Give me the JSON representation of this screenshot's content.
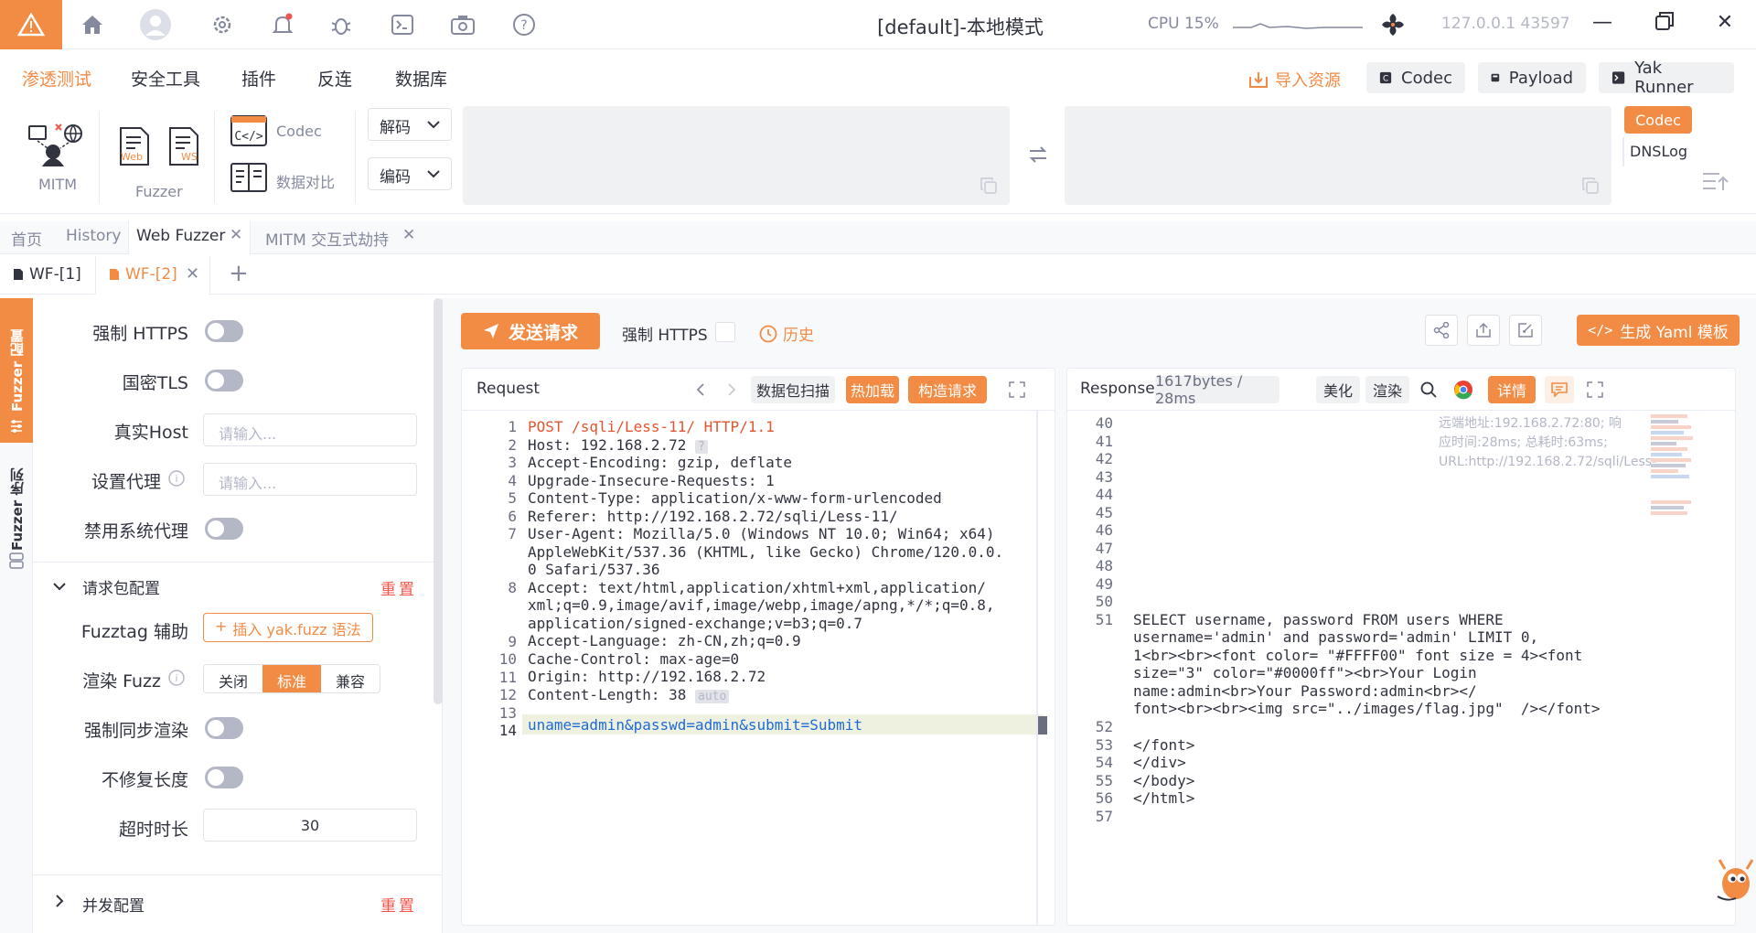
{
  "titlebar": {
    "title": "[default]-本地模式",
    "cpu": "CPU 15%",
    "ip": "127.0.0.1 43597"
  },
  "menu": {
    "items": [
      "渗透测试",
      "安全工具",
      "插件",
      "反连",
      "数据库"
    ],
    "import": "导入资源",
    "codec": "Codec",
    "payload": "Payload",
    "yak_runner": "Yak Runner"
  },
  "ribbon": {
    "mitm": "MITM",
    "fuzzer": "Fuzzer",
    "web_badge": "Web",
    "ws_badge": "WS",
    "codec": "Codec",
    "compare": "数据对比",
    "decode": "解码",
    "encode": "编码",
    "right_codec": "Codec",
    "dnslog": "DNSLog"
  },
  "tabs1": [
    "首页",
    "History",
    "Web Fuzzer",
    "MITM 交互式劫持"
  ],
  "tabs2": [
    "WF-[1]",
    "WF-[2]"
  ],
  "vtabs": [
    "Fuzzer 配置",
    "Fuzzer 序列"
  ],
  "config": {
    "force_https": "强制 HTTPS",
    "gm_tls": "国密TLS",
    "real_host": "真实Host",
    "real_host_ph": "请输入...",
    "proxy": "设置代理",
    "proxy_ph": "请输入...",
    "disable_sys_proxy": "禁用系统代理",
    "request_config": "请求包配置",
    "reset": "重置",
    "fuzztag": "Fuzztag 辅助",
    "insert_yak": "插入 yak.fuzz 语法",
    "render_fuzz": "渲染 Fuzz",
    "render_opts": [
      "关闭",
      "标准",
      "兼容"
    ],
    "sync_render": "强制同步渲染",
    "no_fix_len": "不修复长度",
    "timeout": "超时时长",
    "timeout_val": "30",
    "concurrency": "并发配置",
    "reset2": "重置"
  },
  "toolbar": {
    "send": "发送请求",
    "force_https": "强制 HTTPS",
    "history": "历史",
    "gen_yaml": "生成 Yaml 模板"
  },
  "request": {
    "title": "Request",
    "scan": "数据包扫描",
    "hot_load": "热加载",
    "build": "构造请求",
    "host_hint": "?",
    "auto_hint": "auto"
  },
  "response": {
    "title": "Responses",
    "size": "1617bytes / 28ms",
    "beautify": "美化",
    "render": "渲染",
    "details": "详情",
    "remote_info": "远端地址:192.168.2.72:80; 响应时间:28ms; 总耗时:63ms; URL:http://192.168.2.72/sqli/Less-..."
  },
  "request_lines": [
    "POST /sqli/Less-11/ HTTP/1.1",
    "Host: 192.168.2.72",
    "Accept-Encoding: gzip, deflate",
    "Upgrade-Insecure-Requests: 1",
    "Content-Type: application/x-www-form-urlencoded",
    "Referer: http://192.168.2.72/sqli/Less-11/",
    "User-Agent: Mozilla/5.0 (Windows NT 10.0; Win64; x64)",
    "AppleWebKit/537.36 (KHTML, like Gecko) Chrome/120.0.0.",
    "0 Safari/537.36",
    "Accept: text/html,application/xhtml+xml,application/",
    "xml;q=0.9,image/avif,image/webp,image/apng,*/*;q=0.8,",
    "application/signed-exchange;v=b3;q=0.7",
    "Accept-Language: zh-CN,zh;q=0.9",
    "Cache-Control: max-age=0",
    "Origin: http://192.168.2.72",
    "Content-Length: 38",
    "uname=admin&passwd=admin&submit=Submit"
  ],
  "request_line_numbers": [
    "1",
    "2",
    "3",
    "4",
    "5",
    "6",
    "7",
    "8",
    "9",
    "10",
    "11",
    "12",
    "13",
    "14"
  ],
  "response_line_numbers": [
    "40",
    "41",
    "42",
    "43",
    "44",
    "45",
    "46",
    "47",
    "48",
    "49",
    "50",
    "51",
    "52",
    "53",
    "54",
    "55",
    "56",
    "57"
  ],
  "response_lines": [
    "SELECT username, password FROM users WHERE",
    "username='admin' and password='admin' LIMIT 0,",
    "1<br><br><font color= \"#FFFF00\" font size = 4><font",
    "size=\"3\" color=\"#0000ff\"><br>Your Login",
    "name:admin<br>Your Password:admin<br></",
    "font><br><br><img src=\"../images/flag.jpg\"  /></font>",
    "</font>",
    "</div>",
    "</body>",
    "</html>"
  ],
  "colors": {
    "accent": "#f28b44",
    "danger": "#f6544a",
    "keyword": "#1e6bd6",
    "method": "#e3552f"
  }
}
